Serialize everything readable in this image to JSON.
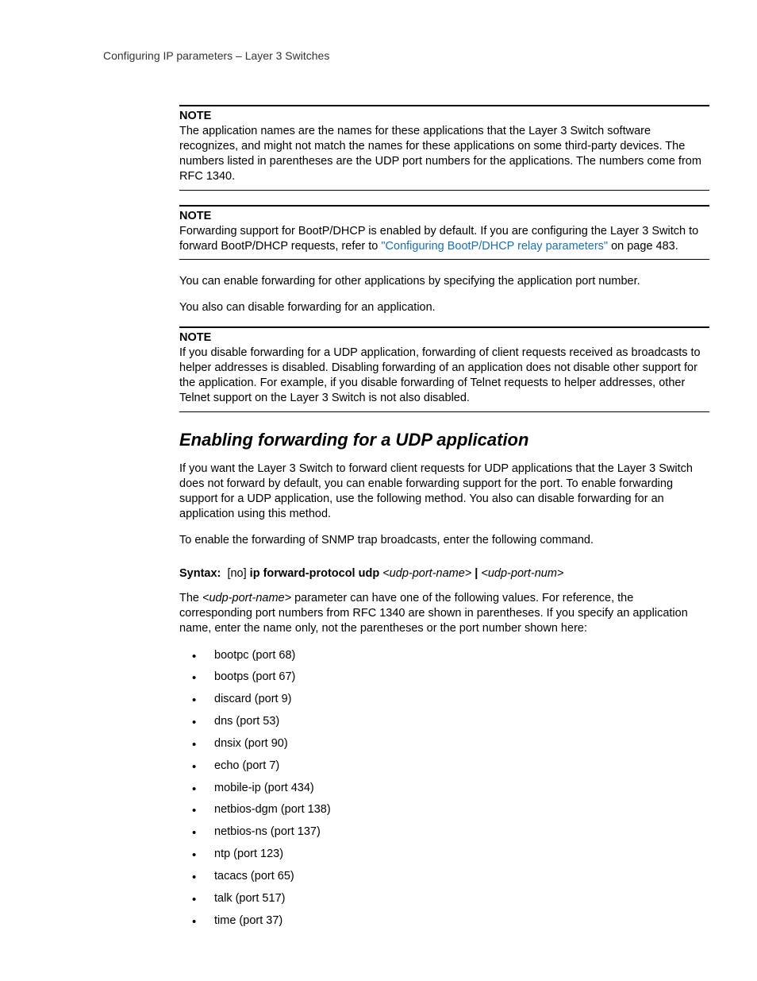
{
  "header": {
    "breadcrumb": "Configuring IP parameters – Layer 3 Switches"
  },
  "notes": {
    "label": "NOTE",
    "n1": "The application names are the names for these applications that the Layer 3 Switch software recognizes, and might not match the names for these applications on some third-party devices.  The numbers listed in parentheses are the UDP port numbers for the applications.  The numbers come from RFC 1340.",
    "n2_pre": "Forwarding support for BootP/DHCP is enabled by default.  If you are configuring the Layer 3 Switch to forward BootP/DHCP requests, refer to ",
    "n2_link": "\"Configuring BootP/DHCP relay parameters\"",
    "n2_post": " on page 483.",
    "n3": "If you disable forwarding for a UDP application, forwarding of client requests received as broadcasts to helper addresses is disabled.  Disabling forwarding of an application does not disable other support for the application.  For example, if you disable forwarding of Telnet requests to helper addresses, other Telnet support on the Layer 3 Switch is not also disabled."
  },
  "paras": {
    "p1": "You can enable forwarding for other applications by specifying the application port number.",
    "p2": "You also can disable forwarding for an application.",
    "sec_intro": "If you want the Layer 3 Switch to forward client requests for UDP applications that the Layer 3 Switch does not forward by default, you can enable forwarding support for the port.  To enable forwarding support for a UDP application, use the following method.  You also can disable forwarding for an application using this method.",
    "sec_cmd": "To enable the forwarding of SNMP trap broadcasts, enter the following command.",
    "params_intro_pre": "The ",
    "params_intro_param": "<udp-port-name>",
    "params_intro_post": " parameter can have one of the following values.  For reference, the corresponding port numbers from RFC 1340 are shown in parentheses.  If you specify an application name, enter the name only, not the parentheses or the port number shown here:"
  },
  "section": {
    "heading": "Enabling forwarding for a UDP application"
  },
  "syntax": {
    "label": "Syntax:",
    "optional": "[no]",
    "cmd": "ip forward-protocol udp",
    "arg1": "<udp-port-name>",
    "pipe": "|",
    "arg2": "<udp-port-num>"
  },
  "ports": [
    "bootpc (port 68)",
    "bootps (port 67)",
    "discard (port 9)",
    "dns (port 53)",
    "dnsix (port 90)",
    "echo (port 7)",
    "mobile-ip (port 434)",
    "netbios-dgm (port 138)",
    "netbios-ns (port 137)",
    "ntp (port 123)",
    "tacacs (port 65)",
    "talk (port 517)",
    "time (port 37)"
  ]
}
